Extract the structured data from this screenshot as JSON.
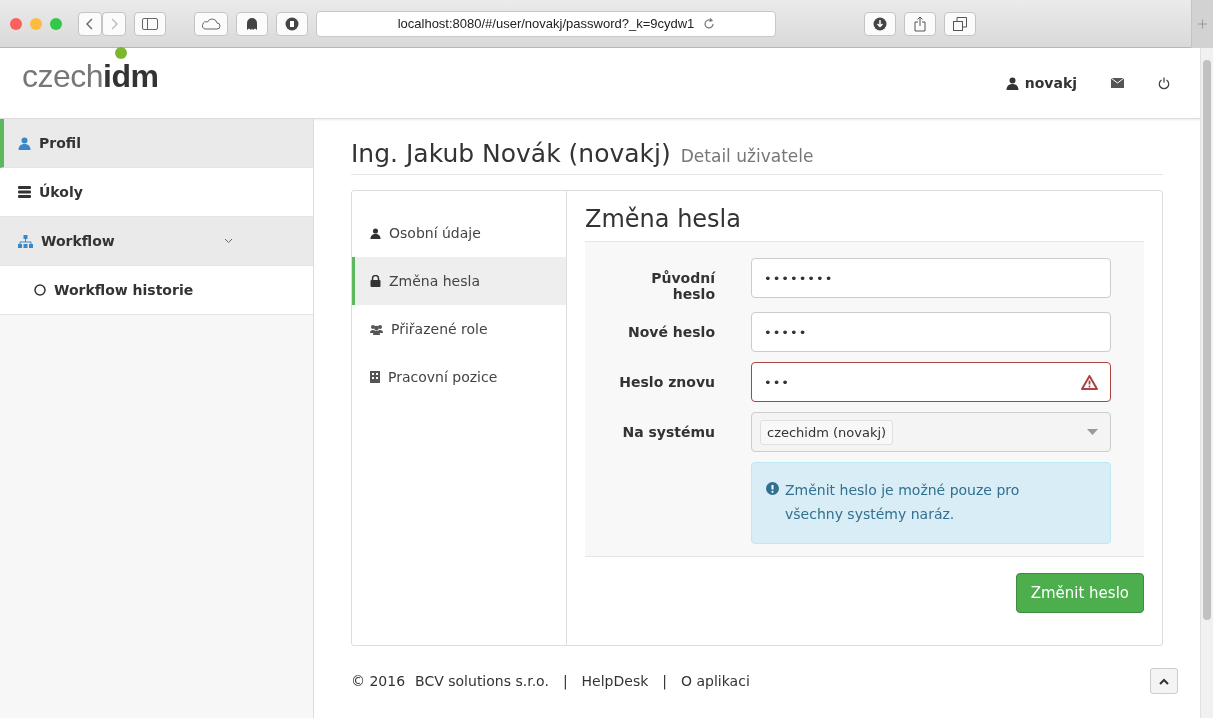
{
  "browser": {
    "url": "localhost:8080/#/user/novakj/password?_k=9cydw1"
  },
  "header": {
    "logo": {
      "part_1": "czech",
      "part_2": "idm"
    },
    "username": "novakj"
  },
  "sidebar": {
    "items": [
      {
        "label": "Profil",
        "selected": true,
        "expanded": false
      },
      {
        "label": "Úkoly",
        "selected": false,
        "expanded": false
      },
      {
        "label": "Workflow",
        "selected": false,
        "expanded": true,
        "children": [
          {
            "label": "Workflow historie",
            "selected": false
          }
        ]
      }
    ]
  },
  "page": {
    "title": "Ing. Jakub Novák (novakj)",
    "subtitle": "Detail uživatele"
  },
  "tabs": [
    {
      "label": "Osobní údaje",
      "selected": false
    },
    {
      "label": "Změna hesla",
      "selected": true
    },
    {
      "label": "Přiřazené role",
      "selected": false
    },
    {
      "label": "Pracovní pozice",
      "selected": false
    }
  ],
  "form": {
    "title": "Změna hesla",
    "fields": [
      {
        "kind": "password",
        "label": "Původní heslo",
        "value": "••••••••",
        "error": false
      },
      {
        "kind": "password",
        "label": "Nové heslo",
        "value": "•••••",
        "error": false
      },
      {
        "kind": "password",
        "label": "Heslo znovu",
        "value": "•••",
        "error": true
      },
      {
        "kind": "select",
        "label": "Na systému",
        "value": "czechidm (novakj)",
        "error": false
      }
    ],
    "info": "Změnit heslo je možné pouze pro všechny systémy naráz.",
    "submit": "Změnit heslo"
  },
  "footer": {
    "copyright": "© 2016",
    "links": [
      "BCV solutions s.r.o.",
      "HelpDesk",
      "O aplikaci"
    ],
    "separator": "|"
  }
}
